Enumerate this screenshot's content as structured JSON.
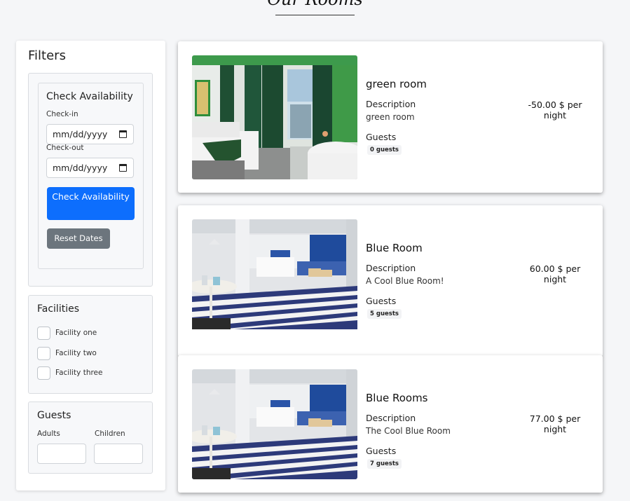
{
  "page": {
    "title": "Our Rooms"
  },
  "filters": {
    "heading": "Filters",
    "availability": {
      "heading": "Check Availability",
      "checkin_label": "Check-in",
      "checkin_placeholder": "mm/dd/yyyy",
      "checkout_label": "Check-out",
      "checkout_placeholder": "mm/dd/yyyy",
      "check_button": "Check Availability",
      "reset_button": "Reset Dates",
      "calendar_icon": "calendar-icon"
    },
    "facilities": {
      "heading": "Facilities",
      "items": [
        {
          "label": "Facility one",
          "checked": false
        },
        {
          "label": "Facility two",
          "checked": false
        },
        {
          "label": "Facility three",
          "checked": false
        }
      ]
    },
    "guests": {
      "heading": "Guests",
      "adults_label": "Adults",
      "children_label": "Children",
      "adults_value": "",
      "children_value": ""
    }
  },
  "rooms": [
    {
      "name": "green room",
      "description_label": "Description",
      "description": "green room",
      "guests_label": "Guests",
      "guests_badge": "0 guests",
      "price": "-50.00 $ per night",
      "image": "green-room-photo"
    },
    {
      "name": "Blue Room",
      "description_label": "Description",
      "description": "A Cool Blue Room!",
      "guests_label": "Guests",
      "guests_badge": "5 guests",
      "price": "60.00 $ per night",
      "image": "blue-room-photo"
    },
    {
      "name": "Blue Rooms",
      "description_label": "Description",
      "description": "The Cool Blue Room",
      "guests_label": "Guests",
      "guests_badge": "7 guests",
      "price": "77.00 $ per night",
      "image": "blue-room-photo"
    }
  ],
  "colors": {
    "primary": "#0d6efd",
    "secondary": "#6c757d",
    "background": "#f5f6f8"
  }
}
